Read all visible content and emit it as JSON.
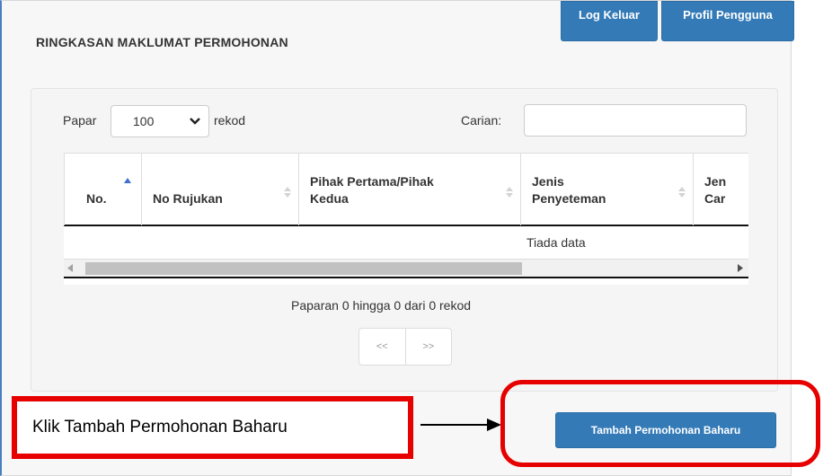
{
  "header": {
    "title": "RINGKASAN MAKLUMAT PERMOHONAN",
    "logout_label": "Log Keluar",
    "profile_label": "Profil Pengguna"
  },
  "controls": {
    "show_label": "Papar",
    "show_value": "100",
    "records_label": "rekod",
    "search_label": "Carian:",
    "search_value": ""
  },
  "table": {
    "columns": [
      {
        "line1": "No.",
        "line2": ""
      },
      {
        "line1": "No Rujukan",
        "line2": ""
      },
      {
        "line1": "Pihak Pertama/Pihak",
        "line2": "Kedua"
      },
      {
        "line1": "Jenis",
        "line2": "Penyeteman"
      },
      {
        "line1": "Jen",
        "line2": "Car"
      }
    ],
    "empty_text": "Tiada data"
  },
  "footer": {
    "info": "Paparan 0 hingga 0 dari 0 rekod",
    "prev_label": "<<",
    "next_label": ">>"
  },
  "actions": {
    "add_label": "Tambah Permohonan Baharu"
  },
  "annotation": {
    "callout_text": "Klik Tambah Permohonan Baharu"
  },
  "colors": {
    "primary": "#337ab7",
    "annotation": "#e60000",
    "sort_active": "#3d6fcf",
    "sort_inactive": "#d3d3d3"
  }
}
